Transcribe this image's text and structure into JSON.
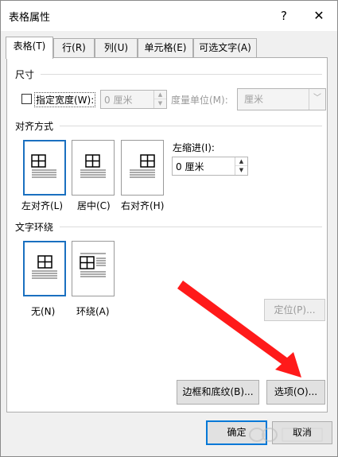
{
  "window": {
    "title": "表格属性",
    "help": "?",
    "close": "✕"
  },
  "tabs": [
    {
      "label": "表格(T)"
    },
    {
      "label": "行(R)"
    },
    {
      "label": "列(U)"
    },
    {
      "label": "单元格(E)"
    },
    {
      "label": "可选文字(A)"
    }
  ],
  "size": {
    "heading": "尺寸",
    "width_checkbox_label": "指定宽度(W):",
    "width_value": "0 厘米",
    "unit_label": "度量单位(M):",
    "unit_value": "厘米"
  },
  "alignment": {
    "heading": "对齐方式",
    "options": [
      {
        "label": "左对齐(L)",
        "selected": true
      },
      {
        "label": "居中(C)",
        "selected": false
      },
      {
        "label": "右对齐(H)",
        "selected": false
      }
    ],
    "indent_label": "左缩进(I):",
    "indent_value": "0 厘米"
  },
  "wrapping": {
    "heading": "文字环绕",
    "options": [
      {
        "label": "无(N)",
        "selected": true
      },
      {
        "label": "环绕(A)",
        "selected": false
      }
    ],
    "position_button": "定位(P)..."
  },
  "buttons": {
    "borders": "边框和底纹(B)...",
    "options": "选项(O)...",
    "ok": "确定",
    "cancel": "取消"
  },
  "annotation": {
    "arrow_color": "#ff1a1a"
  },
  "colors": {
    "accent": "#0078d7",
    "selection": "#1a70c0"
  }
}
